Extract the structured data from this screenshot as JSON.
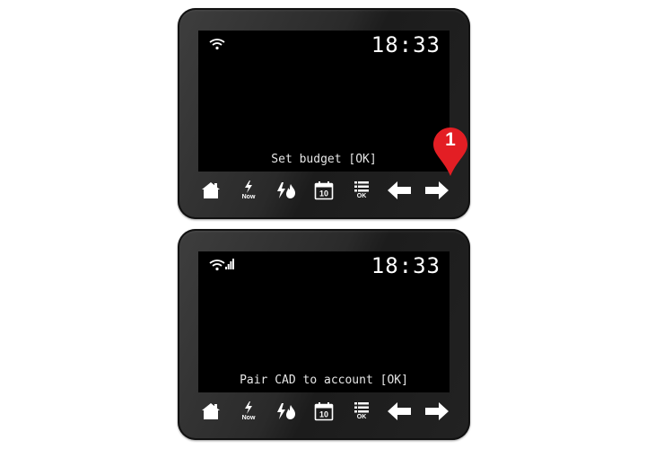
{
  "devices": [
    {
      "clock": "18:33",
      "message": "Set budget [OK]",
      "status_icons": [
        "wifi-icon"
      ]
    },
    {
      "clock": "18:33",
      "message": "Pair CAD to account [OK]",
      "status_icons": [
        "wifi-icon",
        "signal-bars-icon"
      ]
    }
  ],
  "buttons": {
    "home_icon": "home-icon",
    "now_label": "Now",
    "energy_icon": "electricity-gas-icon",
    "calendar_day": "10",
    "menu_ok_label": "OK",
    "back_icon": "arrow-left-icon",
    "forward_icon": "arrow-right-icon"
  },
  "callout": {
    "number": "1",
    "color": "#e31e24"
  }
}
